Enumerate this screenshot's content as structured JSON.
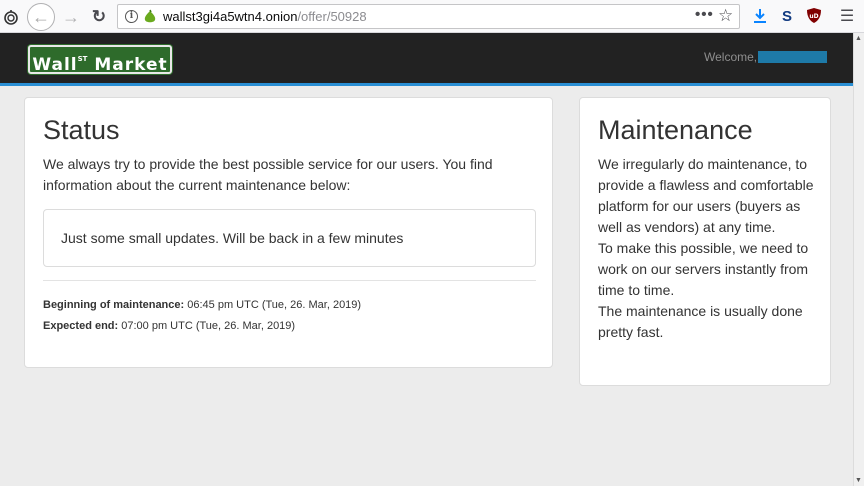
{
  "browser": {
    "url_host": "wallst3gi4a5wtn4.onion",
    "url_path": "/offer/50928",
    "more_label": "•••",
    "ext_s_label": "S",
    "colors": {
      "download": "#0a84ff",
      "ublock": "#800000"
    }
  },
  "site": {
    "logo": {
      "left": "Wall",
      "sup": "ST",
      "right": "Market"
    },
    "welcome": "Welcome,",
    "colors": {
      "navbar": "#222222",
      "accent": "#2a8fd4",
      "logo_bg": "#2e6b2b"
    }
  },
  "status_panel": {
    "title": "Status",
    "intro": "We always try to provide the best possible service for our users. You find information about the current maintenance below:",
    "message": "Just some small updates. Will be back in a few minutes",
    "begin_label": "Beginning of maintenance:",
    "begin_value": " 06:45 pm UTC (Tue, 26. Mar, 2019)",
    "end_label": "Expected end:",
    "end_value": " 07:00 pm UTC (Tue, 26. Mar, 2019)"
  },
  "maintenance_panel": {
    "title": "Maintenance",
    "p1": "We irregularly do maintenance, to provide a flawless and comfortable platform for our users (buyers as well as vendors) at any time.",
    "p2": "To make this possible, we need to work on our servers instantly from time to time.",
    "p3": "The maintenance is usually done pretty fast."
  }
}
